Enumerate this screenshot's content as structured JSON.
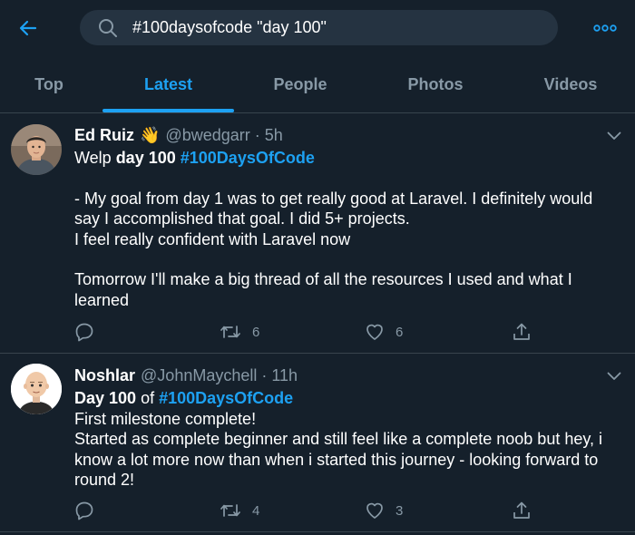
{
  "search": {
    "query": "#100daysofcode \"day 100\""
  },
  "tabs": [
    {
      "label": "Top"
    },
    {
      "label": "Latest"
    },
    {
      "label": "People"
    },
    {
      "label": "Photos"
    },
    {
      "label": "Videos"
    }
  ],
  "tweets": [
    {
      "display_name": "Ed Ruiz",
      "emoji": "👋",
      "handle": "@bwedgarr",
      "time": "5h",
      "title_a": "Welp ",
      "title_b": "day 100",
      "title_c": " ",
      "hashtag": "#100DaysOfCode",
      "body_lines": [
        "- My goal from day 1 was to get really good at Laravel. I definitely would",
        "say I accomplished that goal. I did 5+ projects.",
        "I feel really confident with Laravel now",
        "Tomorrow I'll make a big thread of all the resources I used and what I",
        "learned"
      ],
      "retweets": "6",
      "likes": "6"
    },
    {
      "display_name": "Noshlar",
      "handle": "@JohnMaychell",
      "time": "11h",
      "title_a": "",
      "title_b": "Day 100",
      "title_c": " of ",
      "hashtag": "#100DaysOfCode",
      "body_lines": [
        "First milestone complete!",
        "Started as complete beginner and still feel like a complete noob but hey, i",
        "know a lot more now than when i started this journey - looking forward to",
        "round 2!"
      ],
      "retweets": "4",
      "likes": "3"
    }
  ],
  "colors": {
    "background": "#15202b",
    "accent": "#1da1f2",
    "muted": "#8899a6",
    "divider": "#38444d"
  }
}
